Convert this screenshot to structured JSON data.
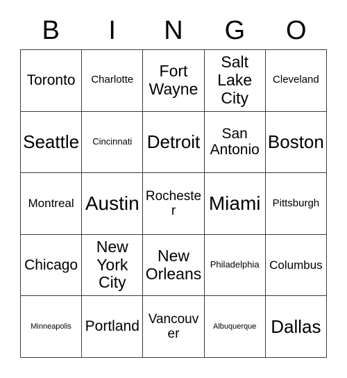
{
  "card": {
    "title": "BINGO",
    "header_letters": [
      "B",
      "I",
      "N",
      "G",
      "O"
    ],
    "grid_size": "5x5",
    "border_color": "#3a3a3a",
    "background_color": "#ffffff",
    "text_color": "#000000",
    "rows": [
      [
        {
          "label": "Toronto",
          "size": "fs-l"
        },
        {
          "label": "Charlotte",
          "size": "fs-sm"
        },
        {
          "label": "Fort\nWayne",
          "size": "fs-xl"
        },
        {
          "label": "Salt\nLake\nCity",
          "size": "fs-xl"
        },
        {
          "label": "Cleveland",
          "size": "fs-sm"
        }
      ],
      [
        {
          "label": "Seattle",
          "size": "fs-xxl"
        },
        {
          "label": "Cincinnati",
          "size": "fs-s"
        },
        {
          "label": "Detroit",
          "size": "fs-xxl"
        },
        {
          "label": "San\nAntonio",
          "size": "fs-l"
        },
        {
          "label": "Boston",
          "size": "fs-xxl"
        }
      ],
      [
        {
          "label": "Montreal",
          "size": "fs-m"
        },
        {
          "label": "Austin",
          "size": "fs-xxxl"
        },
        {
          "label": "Rochester",
          "size": "fs-ml"
        },
        {
          "label": "Miami",
          "size": "fs-xxxl"
        },
        {
          "label": "Pittsburgh",
          "size": "fs-sm"
        }
      ],
      [
        {
          "label": "Chicago",
          "size": "fs-l"
        },
        {
          "label": "New\nYork\nCity",
          "size": "fs-xl"
        },
        {
          "label": "New\nOrleans",
          "size": "fs-xl"
        },
        {
          "label": "Philadelphia",
          "size": "fs-s"
        },
        {
          "label": "Columbus",
          "size": "fs-m"
        }
      ],
      [
        {
          "label": "Minneapolis",
          "size": "fs-xs"
        },
        {
          "label": "Portland",
          "size": "fs-l"
        },
        {
          "label": "Vancouver",
          "size": "fs-ml"
        },
        {
          "label": "Albuquerque",
          "size": "fs-xs"
        },
        {
          "label": "Dallas",
          "size": "fs-xxl"
        }
      ]
    ]
  }
}
